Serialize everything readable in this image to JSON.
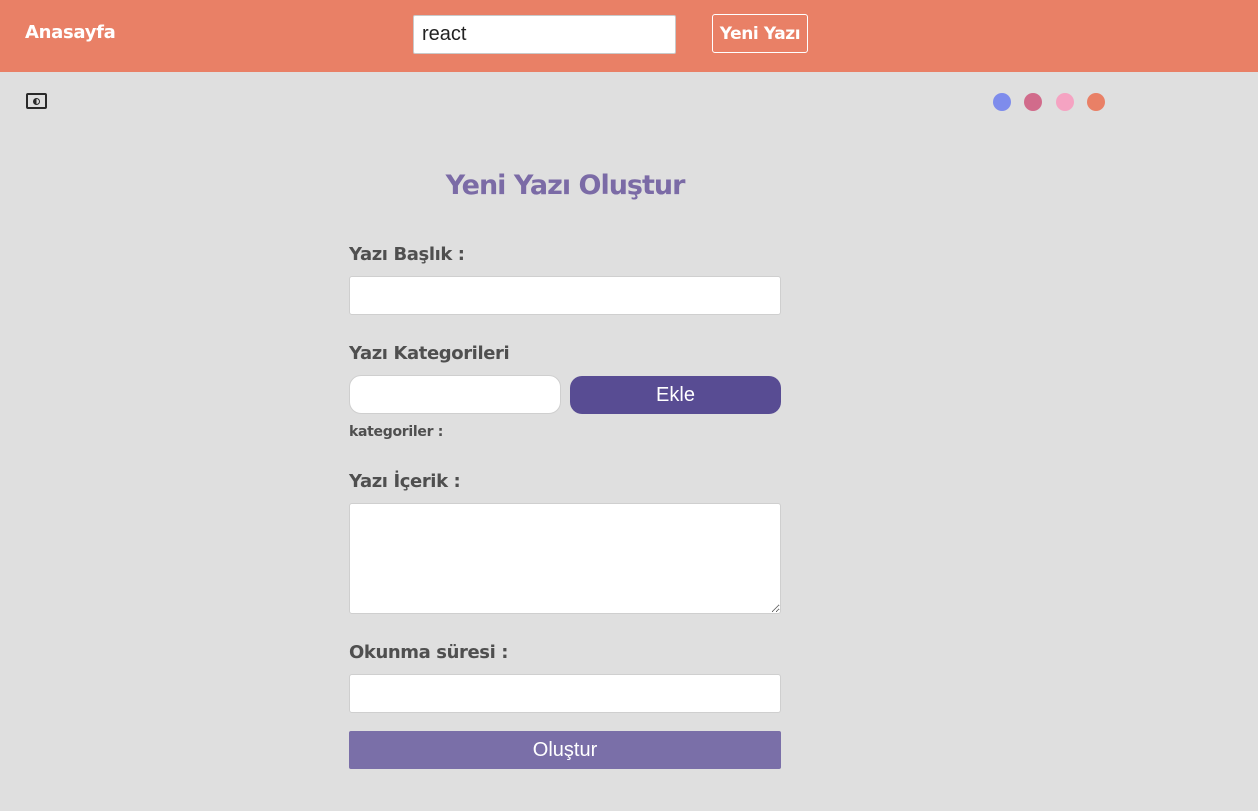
{
  "navbar": {
    "home_label": "Anasayfa",
    "search_value": "react",
    "new_post_label": "Yeni Yazı",
    "background_color": "#e98066"
  },
  "toolbar": {
    "theme_icon": "contrast-toggle-icon",
    "color_swatches": [
      {
        "name": "blue",
        "color": "#7e8cec"
      },
      {
        "name": "rose",
        "color": "#d16b8b"
      },
      {
        "name": "pink",
        "color": "#f5a3c2"
      },
      {
        "name": "coral",
        "color": "#e98066"
      }
    ]
  },
  "form": {
    "title": "Yeni Yazı Oluştur",
    "title_color": "#7b6ba6",
    "post_title_label": "Yazı Başlık :",
    "post_title_value": "",
    "categories_label": "Yazı Kategorileri",
    "category_input_value": "",
    "add_category_label": "Ekle",
    "add_button_color": "#584c93",
    "categories_list_label": "kategoriler :",
    "content_label": "Yazı İçerik :",
    "content_value": "",
    "reading_time_label": "Okunma süresi :",
    "reading_time_value": "",
    "submit_label": "Oluştur",
    "submit_button_color": "#7a6fa8"
  }
}
